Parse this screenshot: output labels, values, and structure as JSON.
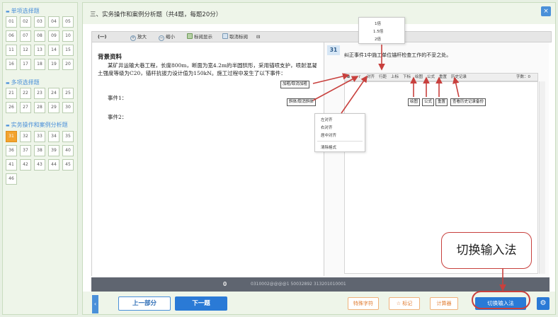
{
  "sidebar": {
    "sections": [
      {
        "title": "单项选择题",
        "items": [
          "01",
          "02",
          "03",
          "04",
          "05",
          "06",
          "07",
          "08",
          "09",
          "10",
          "11",
          "12",
          "13",
          "14",
          "15",
          "16",
          "17",
          "18",
          "19",
          "20"
        ]
      },
      {
        "title": "多项选择题",
        "items": [
          "21",
          "22",
          "23",
          "24",
          "25",
          "26",
          "27",
          "28",
          "29",
          "30"
        ]
      },
      {
        "title": "实务操作和案例分析题",
        "items": [
          "31",
          "32",
          "33",
          "34",
          "35",
          "36",
          "37",
          "38",
          "39",
          "40",
          "41",
          "42",
          "43",
          "44",
          "45",
          "46"
        ]
      }
    ],
    "current": "31"
  },
  "header": {
    "title": "三、实务操作和案例分析题（共4题，每题20分）",
    "close_icon": "×"
  },
  "toolbar": {
    "label": "(一)",
    "zoom_in": "放大",
    "zoom_out": "缩小",
    "highlight": "标阅显示",
    "cancel_highlight": "取消标阅",
    "collapse": "⊟"
  },
  "left_panel": {
    "bg_title": "背景资料",
    "bg_text": "某矿井运输大巷工程，长度800m，断面为宽4.2m的半圆拱形，采用锚喷支护，喷射混凝土强度等级为C20，锚杆抗拔力设计值为150kN。施工过程中发生了以下事件：",
    "event1": "事件1：",
    "event2": "事件2："
  },
  "right_panel": {
    "qnum": "31",
    "question": "纠正事件1中施工单位锚杆检查工作的不妥之处。",
    "editor": {
      "bold": "B",
      "italic": "I",
      "align": "对齐",
      "linespacing": "行距",
      "sup": "上标",
      "sub": "下标",
      "draw": "绘图",
      "formula": "公式",
      "reset": "重置",
      "history": "历史记录",
      "wordcount": "字数：0"
    }
  },
  "statusbar": {
    "num": "0",
    "serial": "0310002@@@@1 50032892 313201010001"
  },
  "bottom": {
    "prev": "上一部分",
    "next": "下一题",
    "special_chars": "特殊字符",
    "mark": "标记",
    "calculator": "计算器",
    "switch_ime": "切换输入法",
    "collapse_icon": "‹",
    "gear_icon": "⚙"
  },
  "annotations": {
    "linespacing_options": [
      "1倍",
      "1.5倍",
      "2倍"
    ],
    "align_options": [
      "左对齐",
      "右对齐",
      "居中对齐"
    ],
    "clear_format": "清除格式",
    "bold_label": "加粗/取消加粗",
    "italic_label": "斜体/取消斜体",
    "draw_label": "绘图",
    "formula_label": "公式",
    "reset_label": "重置",
    "history_label": "查看历史记录备份",
    "callout": "切换输入法"
  },
  "colors": {
    "accent": "#2a7ad6",
    "current_question": "#f3a32e",
    "annotation": "#c8403d"
  }
}
